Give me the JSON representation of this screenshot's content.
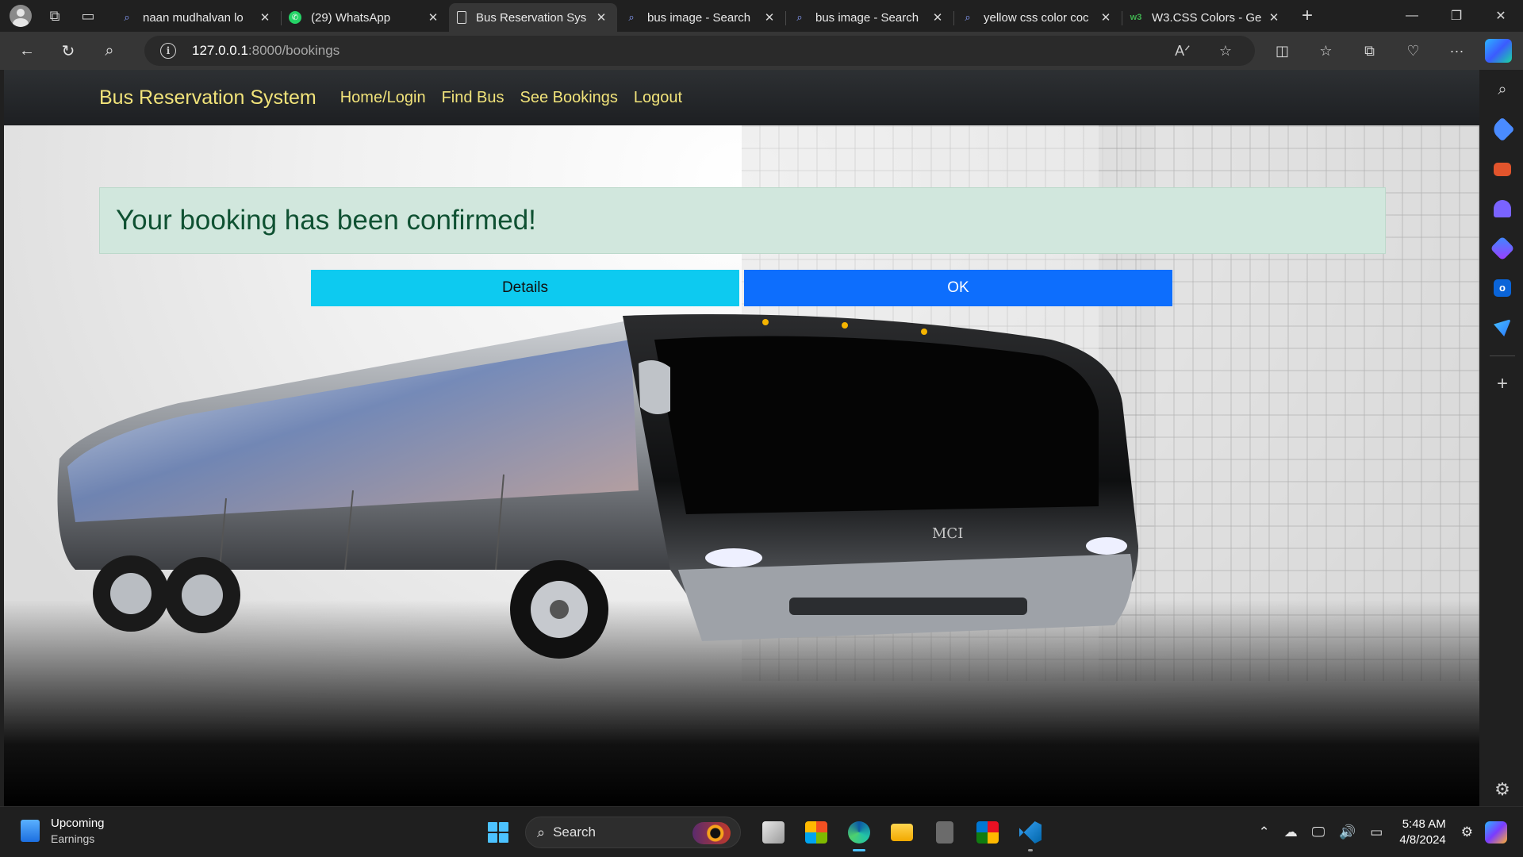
{
  "browser": {
    "tabs": [
      {
        "title": "naan mudhalvan lo",
        "favicon": "search-icon",
        "active": false
      },
      {
        "title": "(29) WhatsApp",
        "favicon": "whatsapp-icon",
        "active": false
      },
      {
        "title": "Bus Reservation Sys",
        "favicon": "page-icon",
        "active": true
      },
      {
        "title": "bus image - Search",
        "favicon": "search-icon",
        "active": false
      },
      {
        "title": "bus image - Search",
        "favicon": "search-icon",
        "active": false
      },
      {
        "title": "yellow css color coc",
        "favicon": "search-icon",
        "active": false
      },
      {
        "title": "W3.CSS Colors - Ge",
        "favicon": "w3-icon",
        "active": false
      }
    ],
    "url_host": "127.0.0.1",
    "url_path": ":8000/bookings"
  },
  "site": {
    "brand": "Bus Reservation System",
    "nav": [
      "Home/Login",
      "Find Bus",
      "See Bookings",
      "Logout"
    ],
    "alert": "Your booking has been confirmed!",
    "details_label": "Details",
    "ok_label": "OK",
    "bus_badge": "MCI",
    "colors": {
      "nav_text": "#f1e37a",
      "alert_bg": "#d1e7dd",
      "alert_text": "#0f5132",
      "details_btn": "#0dcaf0",
      "ok_btn": "#0d6efd"
    }
  },
  "taskbar": {
    "weather_title": "Upcoming",
    "weather_sub": "Earnings",
    "search_placeholder": "Search",
    "time": "5:48 AM",
    "date": "4/8/2024"
  }
}
